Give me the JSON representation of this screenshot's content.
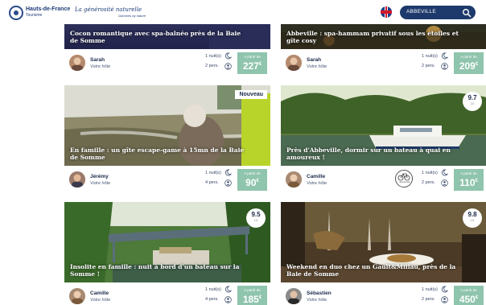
{
  "header": {
    "logo_title": "Hauts-de-France",
    "logo_subtitle": "Tourisme",
    "tagline": "La générosité naturelle",
    "tagline_sub": "Gammes by nature",
    "search_value": "ABBEVILLE",
    "icons": {
      "logo": "hauts-de-france-logo",
      "language": "uk-flag-icon",
      "search": "search-icon"
    }
  },
  "cards": [
    {
      "title": "Cocon romantique avec spa-balnéo près de la Baie de Somme",
      "host": "Sarah",
      "role": "Votre hôte",
      "nights": "1 nuit(s)",
      "persons": "2 pers.",
      "price_from": "A partir de",
      "price": "227",
      "currency": "€"
    },
    {
      "title": "Abbeville : spa-hammam privatif sous les étoiles et gîte cosy",
      "host": "Sarah",
      "role": "Votre hôte",
      "nights": "1 nuit(s)",
      "persons": "2 pers.",
      "price_from": "A partir de",
      "price": "209",
      "currency": "€"
    },
    {
      "title": "En famille : un gîte escape-game à 15mn de la Baie de Somme",
      "badge": "Nouveau",
      "host": "Jérémy",
      "role": "Votre hôte",
      "nights": "1 nuit(s)",
      "persons": "4 pers.",
      "price_from": "A partir de",
      "price": "90",
      "currency": "€"
    },
    {
      "title": "Près d'Abbeville, dormir sur un bateau à quai en amoureux !",
      "rating": "9.7",
      "rating_max": "10",
      "host": "Camille",
      "role": "Votre hôte",
      "label_text": "Accueil vélo",
      "nights": "1 nuit(s)",
      "persons": "2 pers.",
      "price_from": "A partir de",
      "price": "110",
      "currency": "€"
    },
    {
      "title": "Insolite en famille : nuit à bord d'un bateau sur la Somme !",
      "rating": "9.5",
      "rating_max": "10",
      "host": "Camille",
      "role": "Votre hôte",
      "nights": "1 nuit(s)",
      "persons": "4 pers.",
      "price_from": "A partir de",
      "price": "185",
      "currency": "€"
    },
    {
      "title": "Weekend en duo chez un Gault&Millau, près de la Baie de Somme",
      "rating": "9.8",
      "rating_max": "10",
      "host": "Sébastien",
      "role": "Votre hôte",
      "nights": "1 nuit(s)",
      "persons": "2 pers.",
      "price_from": "A partir de",
      "price": "450",
      "currency": "€"
    }
  ]
}
